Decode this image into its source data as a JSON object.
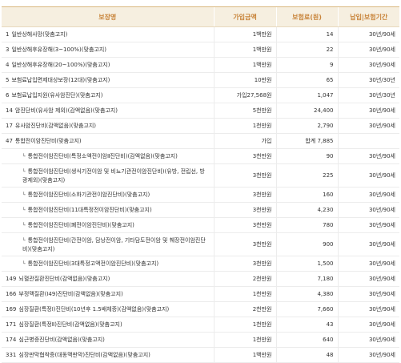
{
  "columns": [
    "보장명",
    "가입금액",
    "보험료(원)",
    "납입|보험기간"
  ],
  "rows": [
    {
      "no": "1",
      "name": "일반상해사망(맞춤고지)",
      "amount": "1백만원",
      "premium": "14",
      "period": "30년/90세"
    },
    {
      "no": "3",
      "name": "일반상해후유장해(3~100%)(맞춤고지)",
      "amount": "1백만원",
      "premium": "22",
      "period": "30년/90세"
    },
    {
      "no": "4",
      "name": "일반상해후유장해(20~100%)(맞춤고지)",
      "amount": "1백만원",
      "premium": "9",
      "period": "30년/90세"
    },
    {
      "no": "5",
      "name": "보험료납입면제대상보장(12대)(맞춤고지)",
      "amount": "10만원",
      "premium": "65",
      "period": "30년/30년"
    },
    {
      "no": "6",
      "name": "보험료납입지원(유사암진단)(맞춤고지)",
      "amount": "가입27,568원",
      "premium": "1,047",
      "period": "30년/30년"
    },
    {
      "no": "14",
      "name": "암진단비(유사암 제외)(감액없음)(맞춤고지)",
      "amount": "5천만원",
      "premium": "24,400",
      "period": "30년/90세"
    },
    {
      "no": "17",
      "name": "유사암진단비(감액없음)(맞춤고지)",
      "amount": "1천만원",
      "premium": "2,790",
      "period": "30년/90세"
    },
    {
      "no": "47",
      "name": "통합전이암진단비(맞춤고지)",
      "amount": "가입",
      "premium": "합계 7,885",
      "period": ""
    },
    {
      "sub": true,
      "name": "통합전이암진단비(특정소액전이암Ⅱ진단비)(감액없음)(맞춤고지)",
      "amount": "3천만원",
      "premium": "90",
      "period": "30년/90세"
    },
    {
      "sub": true,
      "tall": true,
      "name": "통합전이암진단비(생식기전이암 및 비뇨기관전이암진단비)(유방, 전립선, 방광제외)(맞춤고지)",
      "amount": "3천만원",
      "premium": "225",
      "period": "30년/90세"
    },
    {
      "sub": true,
      "name": "통합전이암진단비(소화기관전이암진단비)(맞춤고지)",
      "amount": "3천만원",
      "premium": "160",
      "period": "30년/90세"
    },
    {
      "sub": true,
      "name": "통합전이암진단비(11대특정전이암진단비)(맞춤고지)",
      "amount": "3천만원",
      "premium": "4,230",
      "period": "30년/90세"
    },
    {
      "sub": true,
      "name": "통합전이암진단비(폐전이암진단비)(맞춤고지)",
      "amount": "3천만원",
      "premium": "780",
      "period": "30년/90세"
    },
    {
      "sub": true,
      "tall": true,
      "name": "통합전이암진단비(간전이암, 담낭전이암, 기타담도전이암 및 췌장전이암진단비)(맞춤고지)",
      "amount": "3천만원",
      "premium": "900",
      "period": "30년/90세"
    },
    {
      "sub": true,
      "name": "통합전이암진단비(3대특정고액전이암진단비)(맞춤고지)",
      "amount": "3천만원",
      "premium": "1,500",
      "period": "30년/90세"
    },
    {
      "no": "149",
      "name": "뇌혈관질환진단비(감액없음)(맞춤고지)",
      "amount": "2천만원",
      "premium": "7,180",
      "period": "30년/90세"
    },
    {
      "no": "166",
      "name": "부정맥질환(Ⅰ49)진단비(감액없음)(맞춤고지)",
      "amount": "1천만원",
      "premium": "4,380",
      "period": "30년/90세"
    },
    {
      "no": "169",
      "name": "심장질환(특정Ⅰ)진단비(10년후 1.5배체증)(감액없음)(맞춤고지)",
      "amount": "2천만원",
      "premium": "7,660",
      "period": "30년/90세"
    },
    {
      "no": "171",
      "name": "심장질환(특정Ⅱ)진단비(감액없음)(맞춤고지)",
      "amount": "1천만원",
      "premium": "43",
      "period": "30년/90세"
    },
    {
      "no": "174",
      "name": "심근병증진단비(감액없음)(맞춤고지)",
      "amount": "1천만원",
      "premium": "640",
      "period": "30년/90세"
    },
    {
      "no": "331",
      "name": "심장판막협착증(대동맥판막)진단비(감액없음)(맞춤고지)",
      "amount": "1백만원",
      "premium": "48",
      "period": "30년/90세"
    }
  ]
}
